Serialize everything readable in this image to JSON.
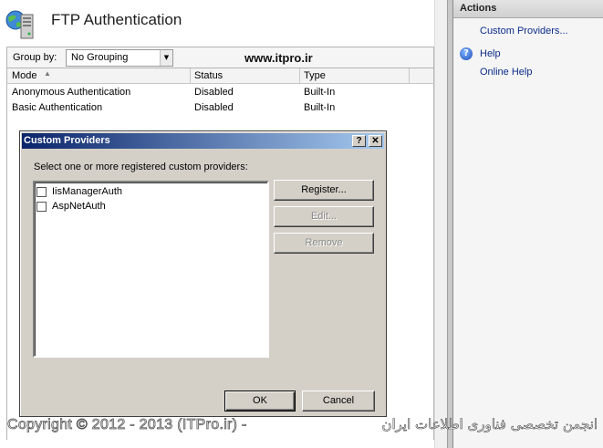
{
  "page": {
    "title": "FTP Authentication",
    "watermark_url": "www.itpro.ir"
  },
  "toolbar": {
    "group_by_label": "Group by:",
    "group_by_value": "No Grouping"
  },
  "grid": {
    "columns": [
      "Mode",
      "Status",
      "Type"
    ],
    "rows": [
      {
        "mode": "Anonymous Authentication",
        "status": "Disabled",
        "type": "Built-In"
      },
      {
        "mode": "Basic Authentication",
        "status": "Disabled",
        "type": "Built-In"
      }
    ]
  },
  "actions": {
    "header": "Actions",
    "custom_providers": "Custom Providers...",
    "help": "Help",
    "online_help": "Online Help"
  },
  "dialog": {
    "title": "Custom Providers",
    "help_btn": "?",
    "close_btn": "✕",
    "prompt": "Select one or more registered custom providers:",
    "providers": [
      {
        "label": "IisManagerAuth",
        "checked": false
      },
      {
        "label": "AspNetAuth",
        "checked": false
      }
    ],
    "register": "Register...",
    "edit": "Edit...",
    "remove": "Remove",
    "ok": "OK",
    "cancel": "Cancel"
  },
  "footer": {
    "copyright": "Copyright © 2012 - 2013 (ITPro.ir) -",
    "persian": "انجمن تخصصی فناوری اطلاعات ایران"
  },
  "colors": {
    "dialog_title_start": "#0a246a",
    "dialog_title_end": "#a6caf0",
    "link": "#0c2b8a"
  }
}
